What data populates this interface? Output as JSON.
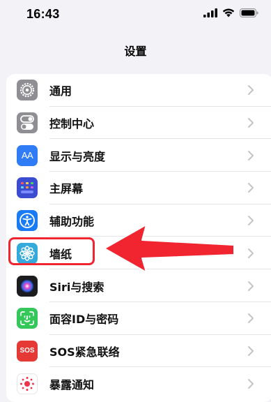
{
  "status_bar": {
    "time": "16:43"
  },
  "nav": {
    "title": "设置"
  },
  "rows": [
    {
      "label": "通用",
      "icon": "gear-icon",
      "color": "#8e8e93"
    },
    {
      "label": "控制中心",
      "icon": "toggles-icon",
      "color": "#8e8e93"
    },
    {
      "label": "显示与亮度",
      "icon": "text-size-icon",
      "color": "#2f7cf6"
    },
    {
      "label": "主屏幕",
      "icon": "home-grid-icon",
      "color": "#3b4cd1"
    },
    {
      "label": "辅助功能",
      "icon": "accessibility-icon",
      "color": "#1a7cf5"
    },
    {
      "label": "墙纸",
      "icon": "flower-icon",
      "color": "#34aadc"
    },
    {
      "label": "Siri与搜索",
      "icon": "siri-icon",
      "color": "#1c1c1e"
    },
    {
      "label": "面容ID与密码",
      "icon": "face-id-icon",
      "color": "#34c759"
    },
    {
      "label": "SOS紧急联络",
      "icon": "sos-icon",
      "color": "#e53935"
    },
    {
      "label": "暴露通知",
      "icon": "exposure-icon",
      "color": "#ffffff"
    }
  ],
  "icon_text": {
    "display": "AA",
    "sos": "SOS"
  },
  "annotation": {
    "highlight_color": "#f0252f",
    "highlighted_item": "墙纸"
  }
}
